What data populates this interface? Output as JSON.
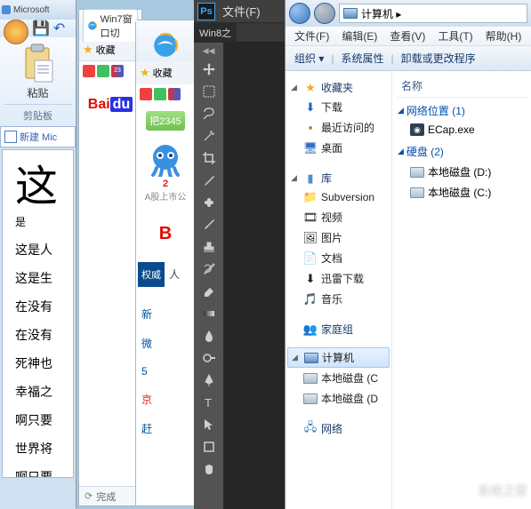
{
  "word": {
    "title_frag": "Microsoft",
    "paste_label": "粘贴",
    "clipboard_section": "剪贴板",
    "doc_tab": "新建 Mic",
    "big_line": "这",
    "sub": "是",
    "lines": [
      "这是人",
      "这是生",
      "在没有",
      "在没有",
      "死神也",
      "幸福之",
      "啊只要",
      "世界将",
      "啊只要"
    ]
  },
  "ie1": {
    "tab_title": "Win7窗口切",
    "fav_label": "收藏",
    "toolbar_icons": [
      "home",
      "lock",
      "2345"
    ],
    "baidu_bai": "Bai",
    "baidu_du": "du",
    "status": "完成"
  },
  "ie2": {
    "fav_label": "收藏",
    "btn_2345": "把2345",
    "octopus_title": "2",
    "octopus_caption": "A股上市公",
    "baidu_b": "B",
    "qw_label": "权威",
    "ren": "人",
    "links": [
      "新",
      "微",
      "5",
      "京",
      "赶"
    ]
  },
  "ps": {
    "menu_file": "文件(F)",
    "tab": "Win8之"
  },
  "explorer": {
    "breadcrumb": "计算机 ▸",
    "menus": [
      "文件(F)",
      "编辑(E)",
      "查看(V)",
      "工具(T)",
      "帮助(H)"
    ],
    "cmds": [
      "组织 ▾",
      "系统属性",
      "卸载或更改程序"
    ],
    "nav": {
      "favorites": "收藏夹",
      "fav_items": [
        {
          "icon": "⬇",
          "label": "下载",
          "color": "#2060c0"
        },
        {
          "icon": "▪",
          "label": "最近访问的",
          "color": "#b07030"
        },
        {
          "icon": "🖥",
          "label": "桌面",
          "color": "#3070c0"
        }
      ],
      "library": "库",
      "lib_items": [
        {
          "icon": "📁",
          "label": "Subversion"
        },
        {
          "icon": "🎞",
          "label": "视频"
        },
        {
          "icon": "🖼",
          "label": "图片"
        },
        {
          "icon": "📄",
          "label": "文档"
        },
        {
          "icon": "⬇",
          "label": "迅雷下载"
        },
        {
          "icon": "🎵",
          "label": "音乐"
        }
      ],
      "homegroup": "家庭组",
      "computer": "计算机",
      "comp_items": [
        "本地磁盘 (C",
        "本地磁盘 (D"
      ],
      "network": "网络"
    },
    "main": {
      "col_name": "名称",
      "grp_netloc": "网络位置 (1)",
      "netloc_items": [
        "ECap.exe"
      ],
      "grp_disk": "硬盘 (2)",
      "disk_items": [
        "本地磁盘 (D:)",
        "本地磁盘 (C:)"
      ]
    }
  },
  "watermark": "系统之家"
}
